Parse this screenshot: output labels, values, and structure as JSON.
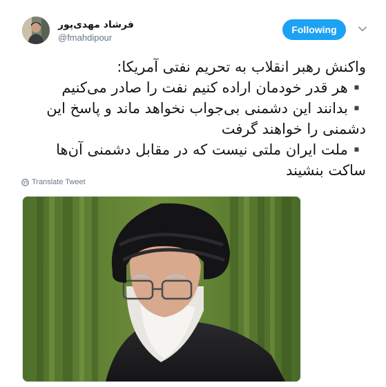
{
  "author": {
    "display_name": "فرشاد مهدی‌پور",
    "handle": "@fmahdipour",
    "avatar_icon": "user-avatar"
  },
  "follow_button": {
    "label": "Following",
    "color": "#1da1f2"
  },
  "menu": {
    "icon": "chevron-down-icon"
  },
  "tweet": {
    "lines": [
      "واکنش رهبر انقلاب به تحریم نفتی آمریکا:",
      "▪️هر قدر خودمان اراده کنیم نفت را صادر می‌کنیم",
      "▪️بدانند این دشمنی بی‌جواب نخواهد ماند و پاسخ این دشمنی را خواهند گرفت",
      "▪️ملت ایران ملتی نیست که در مقابل دشمنی آن‌ها ساکت بنشیند"
    ]
  },
  "translate": {
    "label": "Translate Tweet",
    "icon": "globe-icon"
  },
  "media": {
    "type": "photo",
    "icon": "photo"
  }
}
